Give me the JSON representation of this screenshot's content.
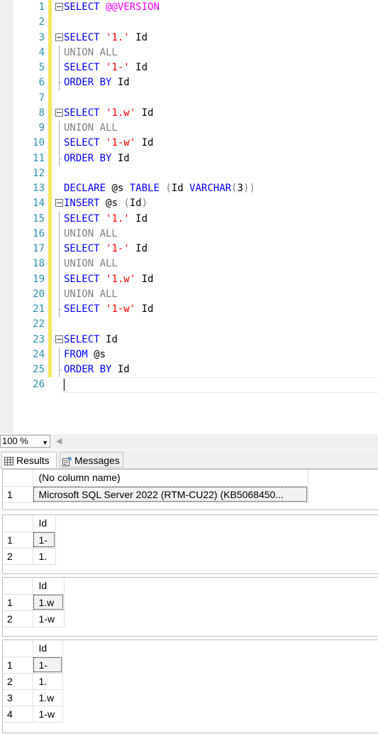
{
  "editor": {
    "lines": [
      {
        "n": "1",
        "fold": true,
        "tokens": [
          {
            "c": "kw",
            "t": "SELECT "
          },
          {
            "c": "pink",
            "t": "@@VERSION"
          }
        ]
      },
      {
        "n": "2",
        "tokens": []
      },
      {
        "n": "3",
        "fold": true,
        "tokens": [
          {
            "c": "kw",
            "t": "SELECT "
          },
          {
            "c": "str",
            "t": "'1.'"
          },
          {
            "c": "txt",
            "t": " Id"
          }
        ]
      },
      {
        "n": "4",
        "guide": true,
        "tokens": [
          {
            "c": "gray",
            "t": "UNION ALL"
          }
        ]
      },
      {
        "n": "5",
        "guide": true,
        "tokens": [
          {
            "c": "kw",
            "t": "SELECT "
          },
          {
            "c": "str",
            "t": "'1-'"
          },
          {
            "c": "txt",
            "t": " Id"
          }
        ]
      },
      {
        "n": "6",
        "guide": "end",
        "tokens": [
          {
            "c": "kw",
            "t": "ORDER BY "
          },
          {
            "c": "txt",
            "t": "Id"
          }
        ]
      },
      {
        "n": "7",
        "tokens": []
      },
      {
        "n": "8",
        "fold": true,
        "tokens": [
          {
            "c": "kw",
            "t": "SELECT "
          },
          {
            "c": "str",
            "t": "'1.w'"
          },
          {
            "c": "txt",
            "t": " Id"
          }
        ]
      },
      {
        "n": "9",
        "guide": true,
        "tokens": [
          {
            "c": "gray",
            "t": "UNION ALL"
          }
        ]
      },
      {
        "n": "10",
        "guide": true,
        "tokens": [
          {
            "c": "kw",
            "t": "SELECT "
          },
          {
            "c": "str",
            "t": "'1-w'"
          },
          {
            "c": "txt",
            "t": " Id"
          }
        ]
      },
      {
        "n": "11",
        "guide": "end",
        "tokens": [
          {
            "c": "kw",
            "t": "ORDER BY "
          },
          {
            "c": "txt",
            "t": "Id"
          }
        ]
      },
      {
        "n": "12",
        "tokens": []
      },
      {
        "n": "13",
        "tokens": [
          {
            "c": "kw",
            "t": "DECLARE "
          },
          {
            "c": "txt",
            "t": "@s "
          },
          {
            "c": "kw",
            "t": "TABLE "
          },
          {
            "c": "gray",
            "t": "("
          },
          {
            "c": "txt",
            "t": "Id "
          },
          {
            "c": "kw",
            "t": "VARCHAR"
          },
          {
            "c": "gray",
            "t": "("
          },
          {
            "c": "txt",
            "t": "3"
          },
          {
            "c": "gray",
            "t": "))"
          }
        ]
      },
      {
        "n": "14",
        "fold": true,
        "tokens": [
          {
            "c": "kw",
            "t": "INSERT "
          },
          {
            "c": "txt",
            "t": "@s "
          },
          {
            "c": "gray",
            "t": "("
          },
          {
            "c": "txt",
            "t": "Id"
          },
          {
            "c": "gray",
            "t": ")"
          }
        ]
      },
      {
        "n": "15",
        "guide": true,
        "tokens": [
          {
            "c": "kw",
            "t": "SELECT "
          },
          {
            "c": "str",
            "t": "'1.'"
          },
          {
            "c": "txt",
            "t": " Id"
          }
        ]
      },
      {
        "n": "16",
        "guide": true,
        "tokens": [
          {
            "c": "gray",
            "t": "UNION ALL"
          }
        ]
      },
      {
        "n": "17",
        "guide": true,
        "tokens": [
          {
            "c": "kw",
            "t": "SELECT "
          },
          {
            "c": "str",
            "t": "'1-'"
          },
          {
            "c": "txt",
            "t": " Id"
          }
        ]
      },
      {
        "n": "18",
        "guide": true,
        "tokens": [
          {
            "c": "gray",
            "t": "UNION ALL"
          }
        ]
      },
      {
        "n": "19",
        "guide": true,
        "tokens": [
          {
            "c": "kw",
            "t": "SELECT "
          },
          {
            "c": "str",
            "t": "'1.w'"
          },
          {
            "c": "txt",
            "t": " Id"
          }
        ]
      },
      {
        "n": "20",
        "guide": true,
        "tokens": [
          {
            "c": "gray",
            "t": "UNION ALL"
          }
        ]
      },
      {
        "n": "21",
        "guide": "end",
        "tokens": [
          {
            "c": "kw",
            "t": "SELECT "
          },
          {
            "c": "str",
            "t": "'1-w'"
          },
          {
            "c": "txt",
            "t": " Id"
          }
        ]
      },
      {
        "n": "22",
        "tokens": []
      },
      {
        "n": "23",
        "fold": true,
        "tokens": [
          {
            "c": "kw",
            "t": "SELECT "
          },
          {
            "c": "txt",
            "t": "Id"
          }
        ]
      },
      {
        "n": "24",
        "guide": true,
        "tokens": [
          {
            "c": "kw",
            "t": "FROM "
          },
          {
            "c": "txt",
            "t": "@s"
          }
        ]
      },
      {
        "n": "25",
        "guide": "end",
        "tokens": [
          {
            "c": "kw",
            "t": "ORDER BY "
          },
          {
            "c": "txt",
            "t": "Id"
          }
        ]
      },
      {
        "n": "26",
        "current": true,
        "tokens": []
      }
    ]
  },
  "status": {
    "zoom": "100 %"
  },
  "tabs": {
    "results": "Results",
    "messages": "Messages"
  },
  "results": [
    {
      "header": "(No column name)",
      "col_width": 388,
      "rows": [
        {
          "n": "1",
          "v": "Microsoft SQL Server 2022 (RTM-CU22) (KB5068450...",
          "sel": true
        }
      ]
    },
    {
      "header": "Id",
      "col_width": 32,
      "rows": [
        {
          "n": "1",
          "v": "1-",
          "sel": true
        },
        {
          "n": "2",
          "v": "1."
        }
      ]
    },
    {
      "header": "Id",
      "col_width": 44,
      "rows": [
        {
          "n": "1",
          "v": "1.w",
          "sel": true
        },
        {
          "n": "2",
          "v": "1-w"
        }
      ]
    },
    {
      "header": "Id",
      "col_width": 42,
      "rows": [
        {
          "n": "1",
          "v": "1-",
          "sel": true
        },
        {
          "n": "2",
          "v": "1."
        },
        {
          "n": "3",
          "v": "1.w"
        },
        {
          "n": "4",
          "v": "1-w"
        }
      ]
    }
  ]
}
